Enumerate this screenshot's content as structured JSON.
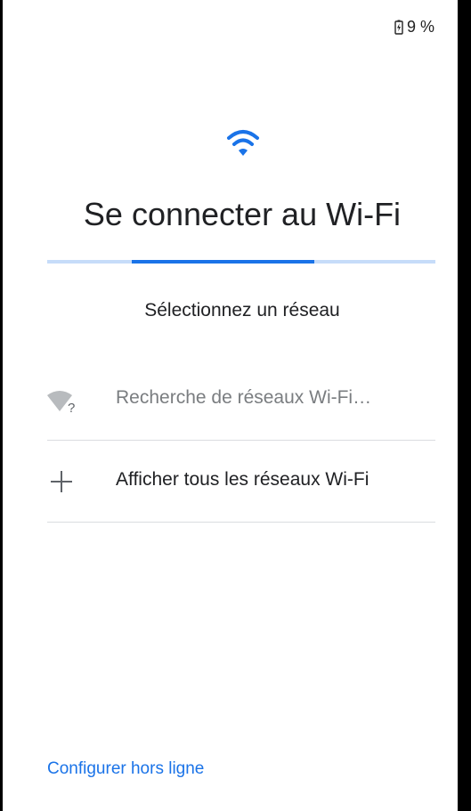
{
  "status_bar": {
    "battery_percent": "9 %",
    "battery_icon": "battery-charging-icon"
  },
  "header": {
    "icon": "wifi-icon",
    "title": "Se connecter au Wi-Fi"
  },
  "progress": {
    "fill_fraction": 0.47,
    "color": "#1a73e8",
    "track_color": "#c6dcf9"
  },
  "subtitle": "Sélectionnez un réseau",
  "network_list": {
    "items": [
      {
        "icon": "wifi-unknown-icon",
        "label": "Recherche de réseaux Wi-Fi…"
      },
      {
        "icon": "plus-icon",
        "label": "Afficher tous les réseaux Wi-Fi"
      }
    ]
  },
  "footer": {
    "offline_link": "Configurer hors ligne"
  },
  "colors": {
    "accent": "#1a73e8",
    "text": "#202124",
    "muted": "#7a7d80",
    "divider": "#dadce0"
  }
}
